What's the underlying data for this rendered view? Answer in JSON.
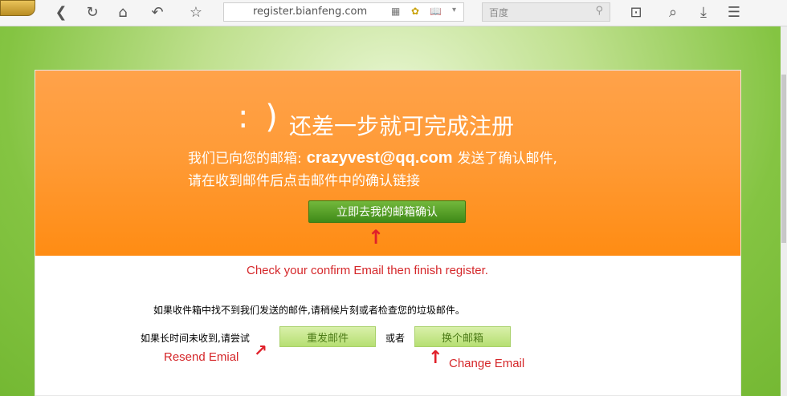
{
  "browser": {
    "url": "register.bianfeng.com",
    "search_placeholder": "百度",
    "icons": [
      "back-icon",
      "refresh-icon",
      "home-icon",
      "undo-icon",
      "star-icon",
      "crop-icon",
      "find-icon",
      "download-icon"
    ]
  },
  "banner": {
    "smile": ": )",
    "title": "还差一步就可完成注册",
    "line1_prefix": "我们已向您的邮箱:",
    "email": "crazyvest@qq.com",
    "line1_suffix": "发送了确认邮件,",
    "line2": "请在收到邮件后点击邮件中的确认链接",
    "confirm_button": "立即去我的邮箱确认"
  },
  "annotations": {
    "main": "Check your confirm Email then finish register.",
    "resend": "Resend Emial",
    "change": "Change Email"
  },
  "help": {
    "info": "如果收件箱中找不到我们发送的邮件,请稍候片刻或者检查您的垃圾邮件。",
    "resend_label": "如果长时间未收到,请尝试",
    "resend_button": "重发邮件",
    "or_text": "或者",
    "change_button": "换个邮箱"
  },
  "colors": {
    "banner": "#ff9b37",
    "green_button": "#4f9a22",
    "annotation": "#d5272a",
    "page_green": "#7bbf3a"
  }
}
